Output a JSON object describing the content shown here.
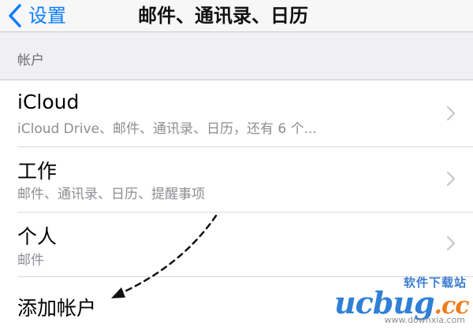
{
  "navbar": {
    "back_label": "设置",
    "title": "邮件、通讯录、日历"
  },
  "accounts_section": {
    "header": "帐户",
    "items": [
      {
        "title": "iCloud",
        "subtitle": "iCloud Drive、邮件、通讯录、日历，还有 6 个..."
      },
      {
        "title": "工作",
        "subtitle": "邮件、通讯录、日历、提醒事项"
      },
      {
        "title": "个人",
        "subtitle": "邮件"
      }
    ],
    "add_account_label": "添加帐户"
  },
  "watermark": {
    "site_name": "软件下载站",
    "logo_text": "ucbug",
    "logo_suffix": ".cc",
    "url": "www.downxia.com"
  },
  "colors": {
    "accent": "#0a7cff",
    "background": "#efeff4",
    "annotation": "#111111"
  },
  "icons": {
    "back": "chevron-left-icon",
    "disclosure": "chevron-right-icon"
  }
}
